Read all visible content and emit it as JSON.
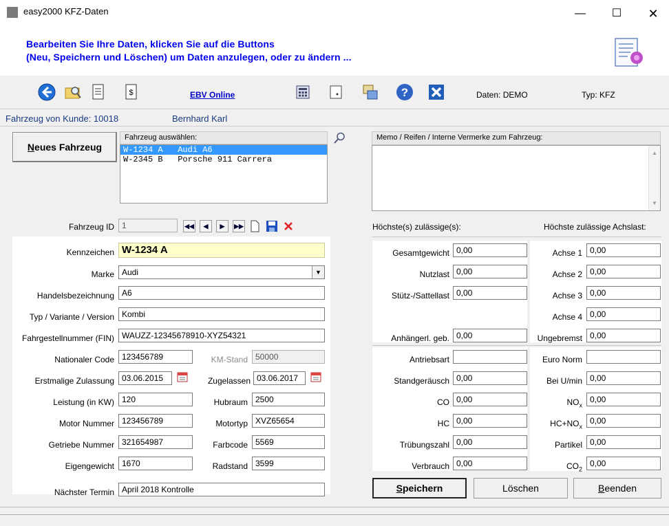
{
  "window": {
    "title": "easy2000 KFZ-Daten",
    "minimize": "—",
    "maximize": "☐",
    "close": "✕"
  },
  "header": {
    "line1": "Bearbeiten Sie Ihre Daten, klicken Sie auf die Buttons",
    "line2": "(Neu, Speichern und Löschen) um Daten anzulegen, oder zu ändern ..."
  },
  "toolbar": {
    "icons": [
      "back-icon",
      "folder-search-icon",
      "document-icon",
      "dollar-document-icon",
      "calculator-icon",
      "notepad-icon",
      "import-export-icon",
      "help-icon",
      "close-icon"
    ],
    "ebv_link": "EBV Online",
    "daten": "Daten: DEMO",
    "typ": "Typ: KFZ"
  },
  "customer": {
    "label": "Fahrzeug von Kunde: 10018",
    "name": "Bernhard Karl"
  },
  "new_vehicle": {
    "label_first": "N",
    "label_rest": "eues Fahrzeug"
  },
  "vehicle_select": {
    "label": "Fahrzeug auswählen:",
    "items": [
      {
        "text": "W-1234 A   Audi A6",
        "selected": true
      },
      {
        "text": "W-2345 B   Porsche 911 Carrera",
        "selected": false
      }
    ]
  },
  "memo": {
    "label": "Memo / Reifen / Interne Vermerke zum Fahrzeug:",
    "value": ""
  },
  "form": {
    "fahrzeug_id": {
      "label": "Fahrzeug ID",
      "value": "1"
    },
    "kennzeichen": {
      "label": "Kennzeichen",
      "value": "W-1234 A"
    },
    "marke": {
      "label": "Marke",
      "value": "Audi"
    },
    "handelsbezeichnung": {
      "label": "Handelsbezeichnung",
      "value": "A6"
    },
    "typ_variante": {
      "label": "Typ / Variante / Version",
      "value": "Kombi"
    },
    "fin": {
      "label": "Fahrgestellnummer (FIN)",
      "value": "WAUZZ-12345678910-XYZ54321"
    },
    "nationaler_code": {
      "label": "Nationaler Code",
      "value": "123456789"
    },
    "km_stand": {
      "label": "KM-Stand",
      "value": "50000"
    },
    "erstzulassung": {
      "label": "Erstmalige Zulassung",
      "value": "03.06.2015"
    },
    "zugelassen": {
      "label": "Zugelassen",
      "value": "03.06.2017"
    },
    "leistung": {
      "label": "Leistung (in KW)",
      "value": "120"
    },
    "hubraum": {
      "label": "Hubraum",
      "value": "2500"
    },
    "motor_nummer": {
      "label": "Motor Nummer",
      "value": "123456789"
    },
    "motortyp": {
      "label": "Motortyp",
      "value": "XVZ65654"
    },
    "getriebe_nummer": {
      "label": "Getriebe Nummer",
      "value": "321654987"
    },
    "farbcode": {
      "label": "Farbcode",
      "value": "5569"
    },
    "eigengewicht": {
      "label": "Eigengewicht",
      "value": "1670"
    },
    "radstand": {
      "label": "Radstand",
      "value": "3599"
    },
    "naechster_termin": {
      "label": "Nächster Termin",
      "value": "April 2018 Kontrolle"
    }
  },
  "weights": {
    "heading_left": "Höchste(s) zulässige(s):",
    "heading_right": "Höchste zulässige Achslast:",
    "gesamtgewicht": {
      "label": "Gesamtgewicht",
      "value": "0,00"
    },
    "nutzlast": {
      "label": "Nutzlast",
      "value": "0,00"
    },
    "stuetzlast": {
      "label": "Stütz-/Sattellast",
      "value": "0,00"
    },
    "anhaenger": {
      "label": "Anhängerl. geb.",
      "value": "0,00"
    },
    "achse1": {
      "label": "Achse 1",
      "value": "0,00"
    },
    "achse2": {
      "label": "Achse 2",
      "value": "0,00"
    },
    "achse3": {
      "label": "Achse 3",
      "value": "0,00"
    },
    "achse4": {
      "label": "Achse 4",
      "value": "0,00"
    },
    "ungebremst": {
      "label": "Ungebremst",
      "value": "0,00"
    }
  },
  "emissions": {
    "antriebsart": {
      "label": "Antriebsart",
      "value": ""
    },
    "euro_norm": {
      "label": "Euro Norm",
      "value": ""
    },
    "standgeraeusch": {
      "label": "Standgeräusch",
      "value": "0,00"
    },
    "bei_umin": {
      "label": "Bei U/min",
      "value": "0,00"
    },
    "co": {
      "label": "CO",
      "value": "0,00"
    },
    "nox": {
      "label_main": "NO",
      "label_sub": "x",
      "value": "0,00"
    },
    "hc": {
      "label": "HC",
      "value": "0,00"
    },
    "hcnox": {
      "label_main": "HC+NO",
      "label_sub": "x",
      "value": "0,00"
    },
    "truebungszahl": {
      "label": "Trübungszahl",
      "value": "0,00"
    },
    "partikel": {
      "label": "Partikel",
      "value": "0,00"
    },
    "verbrauch": {
      "label": "Verbrauch",
      "value": "0,00"
    },
    "co2": {
      "label_main": "CO",
      "label_sub": "2",
      "value": "0,00"
    }
  },
  "buttons": {
    "save_first": "S",
    "save_rest": "peichern",
    "delete": "Löschen",
    "exit_first": "B",
    "exit_rest": "eenden"
  },
  "colors": {
    "header_text": "#0000ee",
    "selection": "#3399ff",
    "highlight_field": "#ffffcc"
  }
}
